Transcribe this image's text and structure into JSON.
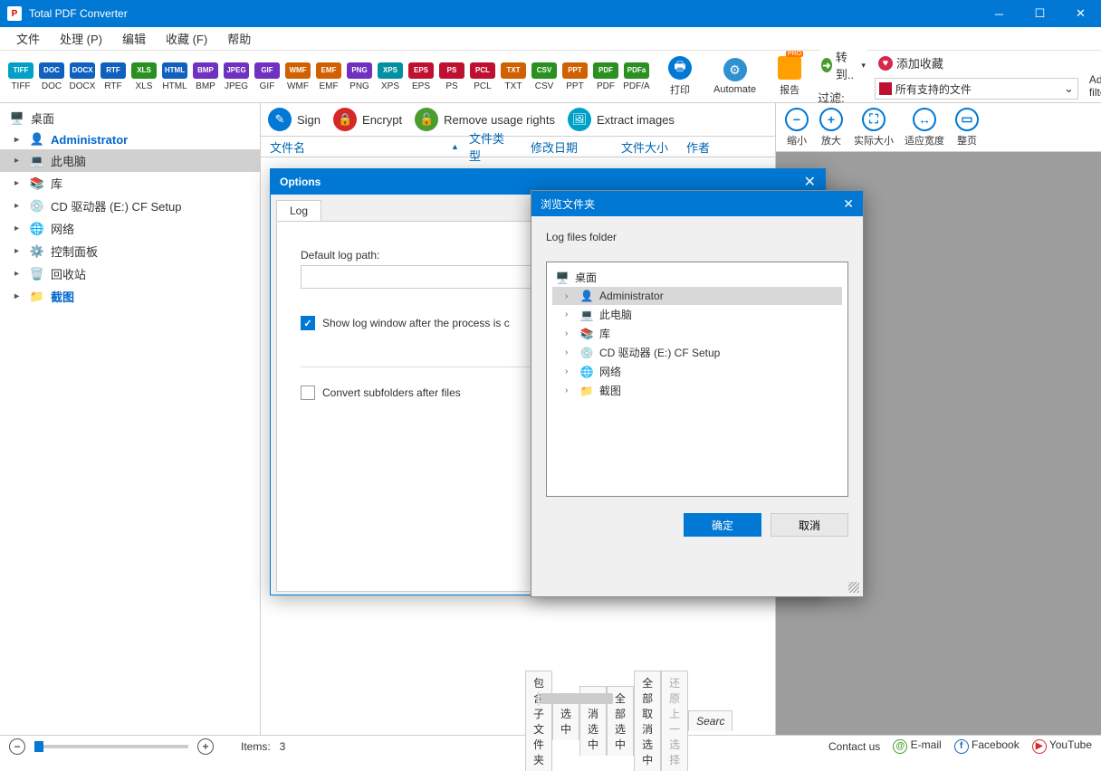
{
  "window": {
    "title": "Total PDF Converter"
  },
  "menu": [
    "文件",
    "处理 (P)",
    "编辑",
    "收藏 (F)",
    "帮助"
  ],
  "formats": [
    {
      "label": "TIFF",
      "badge": "TIFF",
      "color": "#00a0c8"
    },
    {
      "label": "DOC",
      "badge": "DOC",
      "color": "#1060c0"
    },
    {
      "label": "DOCX",
      "badge": "DOCX",
      "color": "#1060c0"
    },
    {
      "label": "RTF",
      "badge": "RTF",
      "color": "#1060c0"
    },
    {
      "label": "XLS",
      "badge": "XLS",
      "color": "#2a9020"
    },
    {
      "label": "HTML",
      "badge": "HTML",
      "color": "#1060c0"
    },
    {
      "label": "BMP",
      "badge": "BMP",
      "color": "#7030c0"
    },
    {
      "label": "JPEG",
      "badge": "JPEG",
      "color": "#7030c0"
    },
    {
      "label": "GIF",
      "badge": "GIF",
      "color": "#7030c0"
    },
    {
      "label": "WMF",
      "badge": "WMF",
      "color": "#d06000"
    },
    {
      "label": "EMF",
      "badge": "EMF",
      "color": "#d06000"
    },
    {
      "label": "PNG",
      "badge": "PNG",
      "color": "#7030c0"
    },
    {
      "label": "XPS",
      "badge": "XPS",
      "color": "#0090a0"
    },
    {
      "label": "EPS",
      "badge": "EPS",
      "color": "#c01030"
    },
    {
      "label": "PS",
      "badge": "PS",
      "color": "#c01030"
    },
    {
      "label": "PCL",
      "badge": "PCL",
      "color": "#c01030"
    },
    {
      "label": "TXT",
      "badge": "TXT",
      "color": "#d06000"
    },
    {
      "label": "CSV",
      "badge": "CSV",
      "color": "#2a9020"
    },
    {
      "label": "PPT",
      "badge": "PPT",
      "color": "#d06000"
    },
    {
      "label": "PDF",
      "badge": "PDF",
      "color": "#2a9020"
    },
    {
      "label": "PDF/A",
      "badge": "PDFa",
      "color": "#2a9020"
    }
  ],
  "bigButtons": {
    "print": "打印",
    "automate": "Automate",
    "report": "报告"
  },
  "pills": {
    "convert": "转到..",
    "favorite": "添加收藏"
  },
  "filter": {
    "label": "过滤:",
    "value": "所有支持的文件",
    "advanced": "Advanced filter"
  },
  "sidebar": {
    "root": "桌面",
    "items": [
      {
        "label": "Administrator",
        "hl": true
      },
      {
        "label": "此电脑",
        "sel": true
      },
      {
        "label": "库"
      },
      {
        "label": "CD 驱动器 (E:) CF Setup"
      },
      {
        "label": "网络"
      },
      {
        "label": "控制面板"
      },
      {
        "label": "回收站"
      },
      {
        "label": "截图",
        "hl": true
      }
    ]
  },
  "actions": {
    "sign": "Sign",
    "encrypt": "Encrypt",
    "remove": "Remove usage rights",
    "extract": "Extract images"
  },
  "columns": {
    "name": "文件名",
    "type": "文件类型",
    "date": "修改日期",
    "size": "文件大小",
    "author": "作者"
  },
  "zoom": {
    "out": "缩小",
    "in": "放大",
    "actual": "实际大小",
    "fit": "适应宽度",
    "page": "整页"
  },
  "bottomTabs": {
    "subfolders": "包含子文件夹",
    "check": "选中",
    "uncheck": "取消选中",
    "checkAll": "全部选中",
    "uncheckAll": "全部取消选中",
    "undo": "还原上一选择",
    "search": "Searc"
  },
  "status": {
    "items_label": "Items:",
    "items_count": "3",
    "contact": "Contact us",
    "email": "E-mail",
    "facebook": "Facebook",
    "youtube": "YouTube"
  },
  "optionsDlg": {
    "title": "Options",
    "tab": "Log",
    "logPathLabel": "Default log path:",
    "logPathValue": "",
    "showLog": "Show log window after the process is c",
    "convertSub": "Convert subfolders after files"
  },
  "browseDlg": {
    "title": "浏览文件夹",
    "prompt": "Log files folder",
    "root": "桌面",
    "items": [
      {
        "label": "Administrator",
        "sel": true
      },
      {
        "label": "此电脑"
      },
      {
        "label": "库"
      },
      {
        "label": "CD 驱动器 (E:) CF Setup"
      },
      {
        "label": "网络"
      },
      {
        "label": "截图"
      }
    ],
    "ok": "确定",
    "cancel": "取消"
  }
}
